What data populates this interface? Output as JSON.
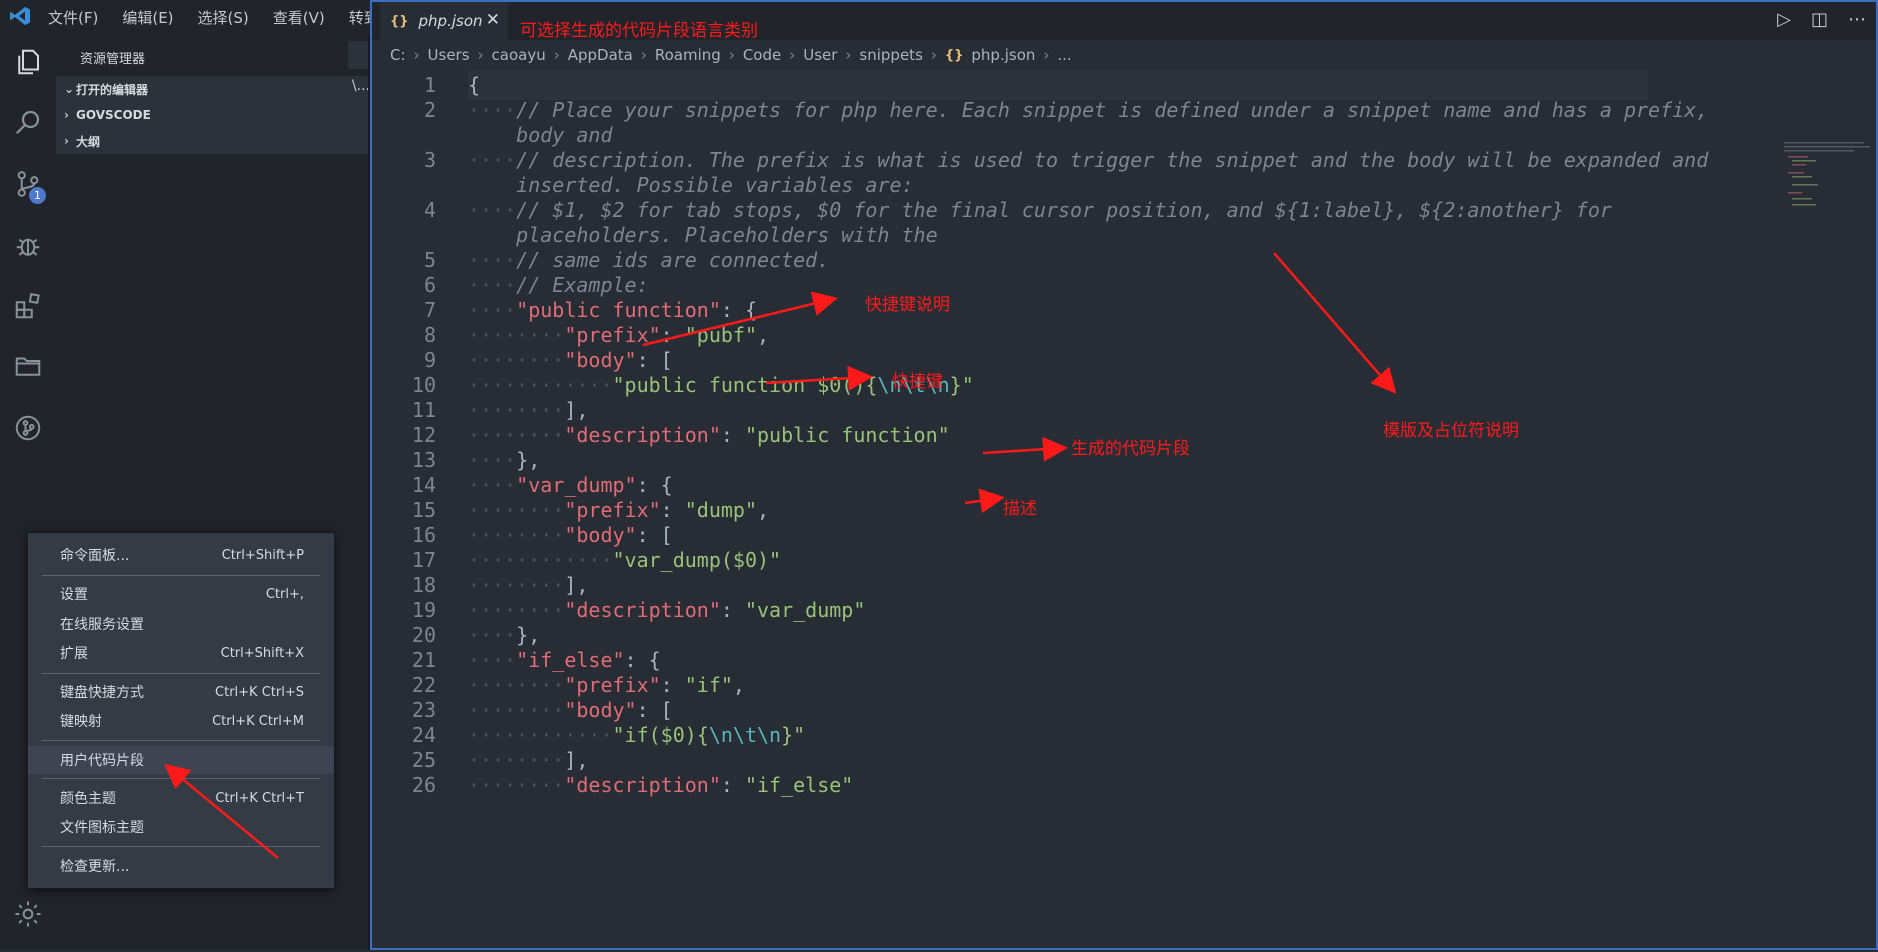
{
  "menubar": {
    "items": [
      "文件(F)",
      "编辑(E)",
      "选择(S)",
      "查看(V)",
      "转到"
    ]
  },
  "activity": {
    "scm_badge": "1"
  },
  "sidebar": {
    "title": "资源管理器",
    "sections": [
      {
        "label": "打开的编辑器",
        "extra": "\\..."
      },
      {
        "label": "GOVSCODE"
      },
      {
        "label": "大纲"
      }
    ]
  },
  "context_menu": {
    "items": [
      {
        "label": "命令面板...",
        "shortcut": "Ctrl+Shift+P"
      },
      {
        "label": "设置",
        "shortcut": "Ctrl+,"
      },
      {
        "label": "在线服务设置",
        "shortcut": ""
      },
      {
        "label": "扩展",
        "shortcut": "Ctrl+Shift+X"
      },
      {
        "label": "键盘快捷方式",
        "shortcut": "Ctrl+K Ctrl+S"
      },
      {
        "label": "键映射",
        "shortcut": "Ctrl+K Ctrl+M"
      },
      {
        "label": "用户代码片段",
        "shortcut": ""
      },
      {
        "label": "颜色主题",
        "shortcut": "Ctrl+K Ctrl+T"
      },
      {
        "label": "文件图标主题",
        "shortcut": ""
      },
      {
        "label": "检查更新...",
        "shortcut": ""
      }
    ]
  },
  "editor": {
    "tab": {
      "icon": "{}",
      "label": "php.json",
      "close": "✕"
    },
    "breadcrumb": [
      "C:",
      "Users",
      "caoayu",
      "AppData",
      "Roaming",
      "Code",
      "User",
      "snippets",
      "php.json",
      "..."
    ],
    "line_numbers": [
      "1",
      "2",
      "3",
      "4",
      "5",
      "6",
      "7",
      "8",
      "9",
      "10",
      "11",
      "12",
      "13",
      "14",
      "15",
      "16",
      "17",
      "18",
      "19",
      "20",
      "21",
      "22",
      "23",
      "24",
      "25",
      "26"
    ],
    "lines": {
      "l1": "{",
      "l2a": "// Place your snippets for php here. Each snippet is defined under a snippet name and has a prefix,",
      "l2b": "body and",
      "l3a": "// description. The prefix is what is used to trigger the snippet and the body will be expanded and",
      "l3b": "inserted. Possible variables are:",
      "l4a": "// $1, $2 for tab stops, $0 for the final cursor position, and ${1:label}, ${2:another} for",
      "l4b": "placeholders. Placeholders with the",
      "l5": "// same ids are connected.",
      "l6": "// Example:",
      "k_public_function": "\"public function\"",
      "k_prefix": "\"prefix\"",
      "v_pubf": "\"pubf\"",
      "k_body": "\"body\"",
      "v_public_body_a": "\"public function $0(){",
      "v_esc": "\\n\\t\\n",
      "v_close": "}\"",
      "k_description": "\"description\"",
      "v_public_function": "\"public function\"",
      "k_var_dump": "\"var_dump\"",
      "v_dump": "\"dump\"",
      "v_var_dump_body": "\"var_dump($0)\"",
      "v_var_dump": "\"var_dump\"",
      "k_if_else": "\"if_else\"",
      "v_if": "\"if\"",
      "v_if_body_a": "\"if($0){",
      "v_if_else": "\"if_else\""
    }
  },
  "annotations": {
    "language_hint": "可选择生成的代码片段语言类别",
    "shortcut_desc": "快捷键说明",
    "shortcut": "快捷键",
    "generated_snippet": "生成的代码片段",
    "description": "描述",
    "template_placeholder": "模版及占位符说明"
  },
  "colors": {
    "accent": "#3a6dc5",
    "annotation_red": "#ff1a1a",
    "keyword": "#e06c75",
    "string": "#98c379",
    "escape": "#56b6c2",
    "comment": "#7f848e"
  }
}
